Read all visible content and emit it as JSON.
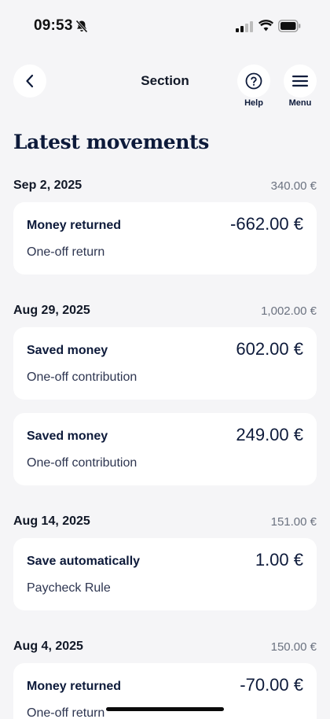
{
  "status_bar": {
    "time": "09:53"
  },
  "nav": {
    "title": "Section",
    "help_label": "Help",
    "menu_label": "Menu"
  },
  "page_title": "Latest movements",
  "groups": [
    {
      "date": "Sep 2, 2025",
      "total": "340.00 €",
      "items": [
        {
          "title": "Money returned",
          "subtitle": "One-off return",
          "amount": "-662.00 €"
        }
      ]
    },
    {
      "date": "Aug 29, 2025",
      "total": "1,002.00 €",
      "items": [
        {
          "title": "Saved money",
          "subtitle": "One-off contribution",
          "amount": "602.00 €"
        },
        {
          "title": "Saved money",
          "subtitle": "One-off contribution",
          "amount": "249.00 €"
        }
      ]
    },
    {
      "date": "Aug 14, 2025",
      "total": "151.00 €",
      "items": [
        {
          "title": "Save automatically",
          "subtitle": "Paycheck Rule",
          "amount": "1.00 €"
        }
      ]
    },
    {
      "date": "Aug 4, 2025",
      "total": "150.00 €",
      "items": [
        {
          "title": "Money returned",
          "subtitle": "One-off return",
          "amount": "-70.00 €"
        }
      ]
    }
  ]
}
